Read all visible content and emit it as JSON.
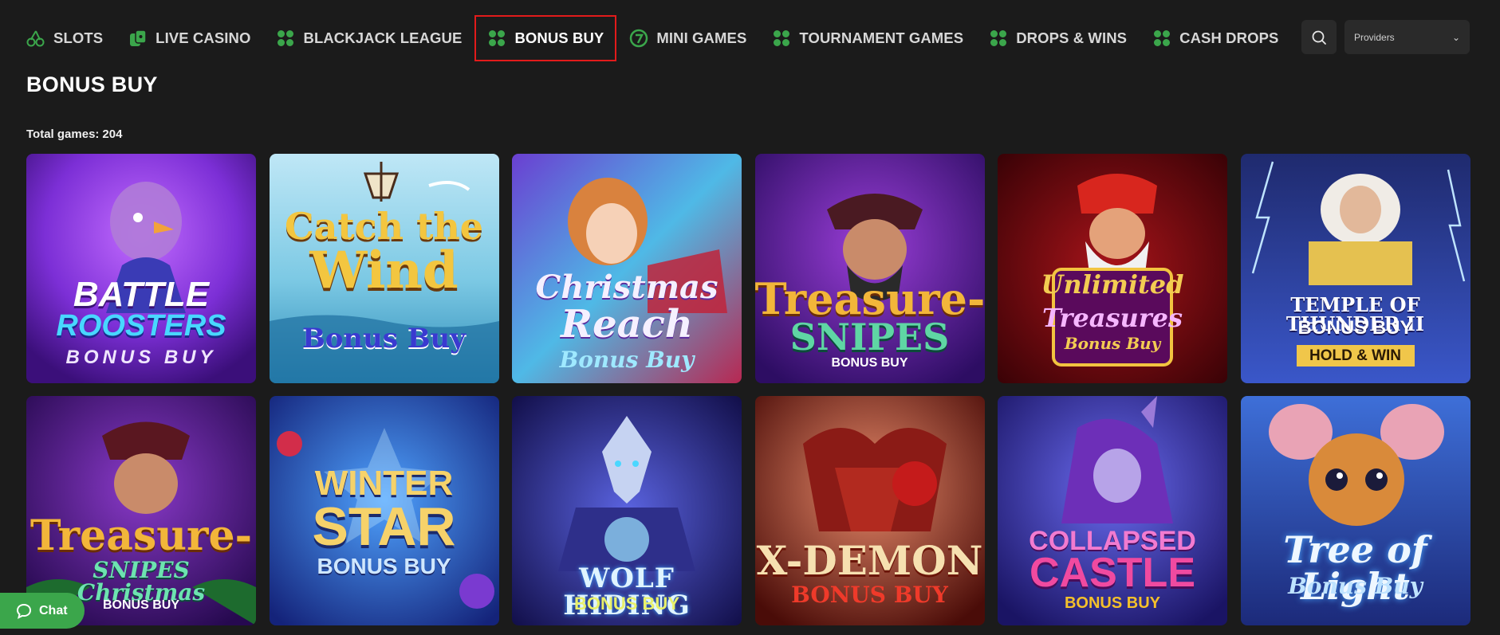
{
  "nav": {
    "items": [
      {
        "label": "SLOTS",
        "icon": "cherries-icon"
      },
      {
        "label": "LIVE CASINO",
        "icon": "dice-card-icon"
      },
      {
        "label": "BLACKJACK LEAGUE",
        "icon": "clover-icon"
      },
      {
        "label": "BONUS BUY",
        "icon": "clover-icon"
      },
      {
        "label": "MINI GAMES",
        "icon": "seven-coin-icon"
      },
      {
        "label": "TOURNAMENT GAMES",
        "icon": "clover-icon"
      },
      {
        "label": "DROPS & WINS",
        "icon": "clover-icon"
      },
      {
        "label": "CASH DROPS",
        "icon": "clover-icon"
      }
    ],
    "active_index": 3
  },
  "search": {
    "icon": "search-icon"
  },
  "providers": {
    "label": "Providers",
    "icon": "chevron-down-icon"
  },
  "page": {
    "title": "BONUS BUY",
    "total_label": "Total games:",
    "total_count": "204"
  },
  "games": [
    {
      "l1": "BATTLE",
      "l2": "ROOSTERS",
      "l3": "BONUS BUY"
    },
    {
      "l1": "Catch the",
      "l2": "Wind",
      "l3": "Bonus Buy"
    },
    {
      "l1": "Christmas",
      "l2": "Reach",
      "l3": "Bonus Buy"
    },
    {
      "l1": "Treasure-",
      "l2": "SNIPES",
      "l3": "BONUS BUY"
    },
    {
      "l1": "Unlimited",
      "l2": "Treasures",
      "l3": "Bonus Buy"
    },
    {
      "l1": "TEMPLE OF THUNDER II",
      "l2": "BONUS BUY",
      "l3": "HOLD & WIN"
    },
    {
      "l1": "Treasure-",
      "l2": "SNIPES Christmas",
      "l3": "BONUS BUY"
    },
    {
      "l1": "WINTER",
      "l2": "STAR",
      "l3": "BONUS BUY"
    },
    {
      "l1": "",
      "l2": "WOLF HIDING",
      "l3": "BONUS BUY"
    },
    {
      "l1": "",
      "l2": "X-DEMON",
      "l3": "BONUS BUY"
    },
    {
      "l1": "COLLAPSED",
      "l2": "CASTLE",
      "l3": "BONUS BUY"
    },
    {
      "l1": "Tree of Light",
      "l2": "",
      "l3": "Bonus Buy"
    }
  ],
  "chat": {
    "label": "Chat",
    "icon": "chat-bubble-icon"
  },
  "colors": {
    "accent_green": "#3ba64b",
    "active_border": "#e21b1b",
    "background": "#1b1b1b"
  }
}
